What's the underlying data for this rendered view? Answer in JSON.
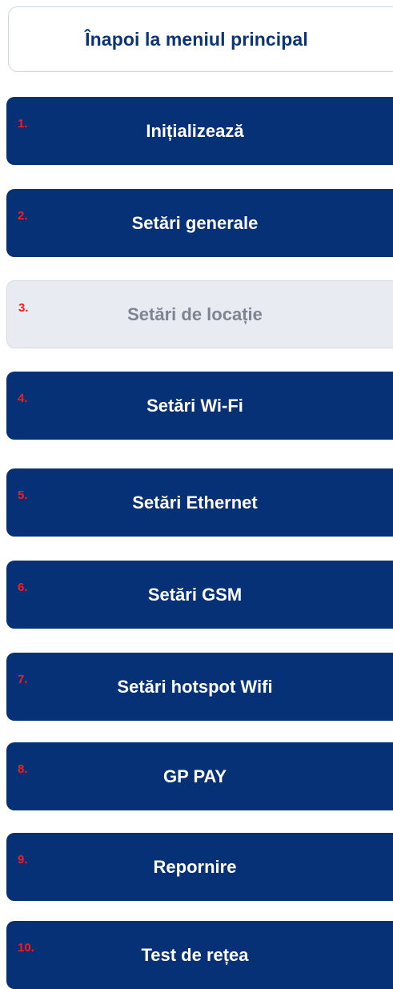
{
  "back_button": {
    "label": "Înapoi la meniul principal"
  },
  "colors": {
    "primary": "#063177",
    "disabled_bg": "#e8ebf1",
    "number_red": "#ff1a1a",
    "back_text": "#0a3478"
  },
  "menu": {
    "items": [
      {
        "number": "1.",
        "label": "Inițializează",
        "enabled": true
      },
      {
        "number": "2.",
        "label": "Setări generale",
        "enabled": true
      },
      {
        "number": "3.",
        "label": "Setări de locație",
        "enabled": false
      },
      {
        "number": "4.",
        "label": "Setări Wi-Fi",
        "enabled": true
      },
      {
        "number": "5.",
        "label": "Setări Ethernet",
        "enabled": true
      },
      {
        "number": "6.",
        "label": "Setări GSM",
        "enabled": true
      },
      {
        "number": "7.",
        "label": "Setări hotspot Wifi",
        "enabled": true
      },
      {
        "number": "8.",
        "label": "GP PAY",
        "enabled": true
      },
      {
        "number": "9.",
        "label": "Repornire",
        "enabled": true
      },
      {
        "number": "10.",
        "label": "Test de rețea",
        "enabled": true
      }
    ]
  }
}
